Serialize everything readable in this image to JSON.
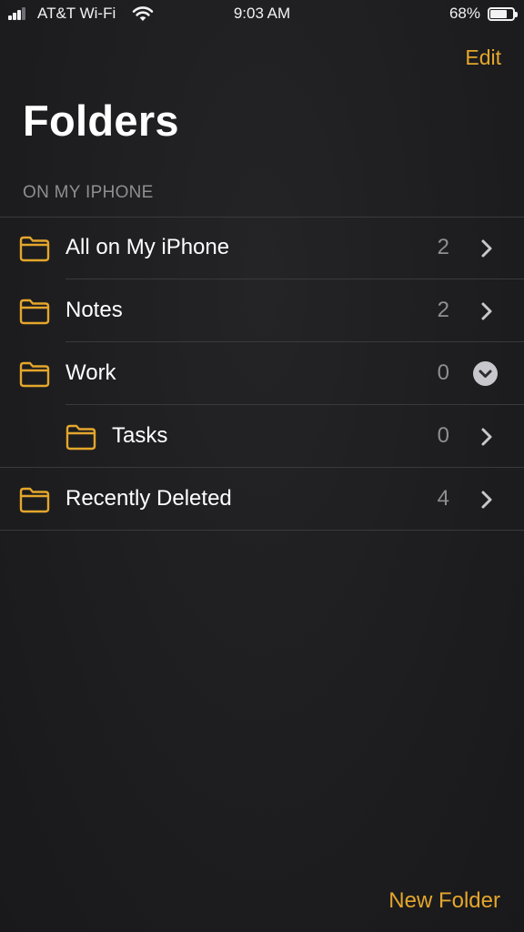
{
  "status_bar": {
    "carrier": "AT&T Wi-Fi",
    "time": "9:03 AM",
    "battery_percent": "68%"
  },
  "nav": {
    "edit_label": "Edit",
    "title": "Folders"
  },
  "section": {
    "header": "ON MY IPHONE"
  },
  "folders": [
    {
      "label": "All on My iPhone",
      "count": "2",
      "icon": "folder-icon",
      "accessory": "chevron-right-icon"
    },
    {
      "label": "Notes",
      "count": "2",
      "icon": "folder-icon",
      "accessory": "chevron-right-icon"
    },
    {
      "label": "Work",
      "count": "0",
      "icon": "folder-icon",
      "accessory": "collapse-circle-icon"
    },
    {
      "label": "Tasks",
      "count": "0",
      "icon": "folder-icon",
      "accessory": "chevron-right-icon",
      "indented": true
    },
    {
      "label": "Recently Deleted",
      "count": "4",
      "icon": "folder-icon",
      "accessory": "chevron-right-icon"
    }
  ],
  "toolbar": {
    "new_folder_label": "New Folder"
  },
  "colors": {
    "accent": "#e4a62c",
    "background": "#1f1f21",
    "secondary_text": "#8e8e93",
    "separator": "#3a3a3c"
  }
}
